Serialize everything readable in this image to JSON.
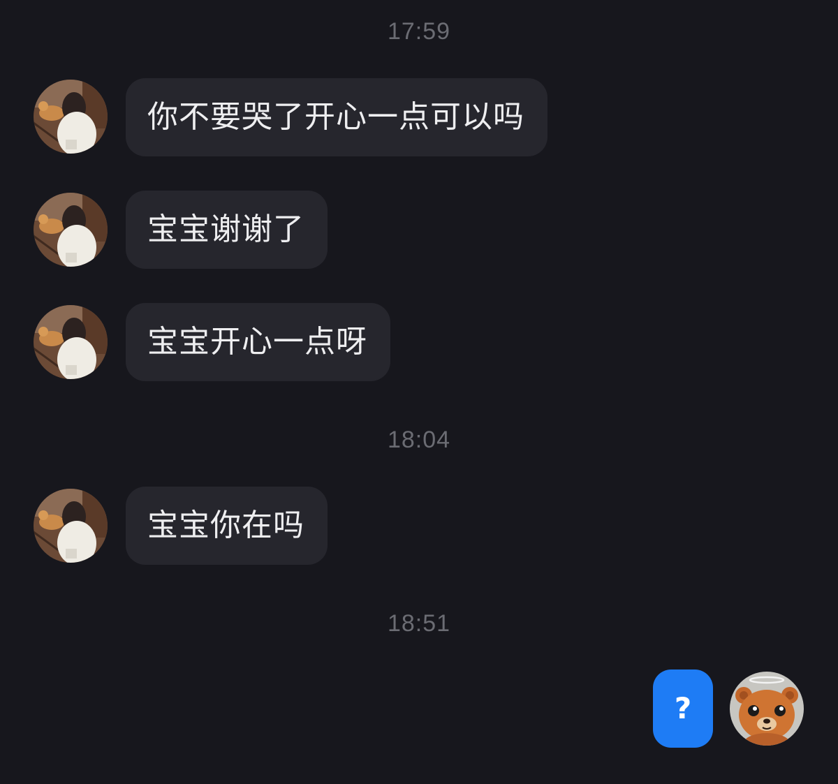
{
  "conversation": {
    "items": [
      {
        "type": "time",
        "text": "17:59"
      },
      {
        "type": "message",
        "side": "incoming",
        "text": "你不要哭了开心一点可以吗",
        "avatar": "girl-with-dog-photo"
      },
      {
        "type": "message",
        "side": "incoming",
        "text": "宝宝谢谢了",
        "avatar": "girl-with-dog-photo"
      },
      {
        "type": "message",
        "side": "incoming",
        "text": "宝宝开心一点呀",
        "avatar": "girl-with-dog-photo"
      },
      {
        "type": "time",
        "text": "18:04"
      },
      {
        "type": "message",
        "side": "incoming",
        "text": "宝宝你在吗",
        "avatar": "girl-with-dog-photo"
      },
      {
        "type": "time",
        "text": "18:51"
      },
      {
        "type": "message",
        "side": "outgoing",
        "text": "?",
        "avatar": "teddy-bear-with-halo"
      }
    ]
  },
  "colors": {
    "background": "#17171d",
    "incoming_bubble": "#26262d",
    "outgoing_bubble": "#1e7cf5",
    "timestamp_text": "#6b6c73",
    "message_text": "#eeeef0"
  }
}
